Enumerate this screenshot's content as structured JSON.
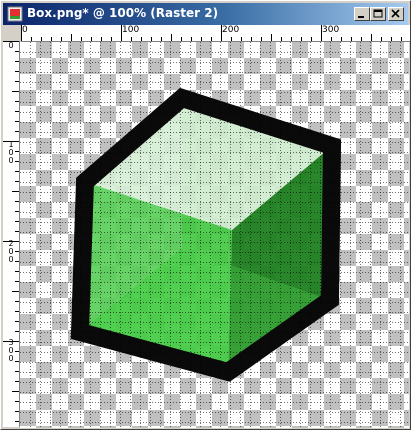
{
  "window": {
    "title": "Box.png* @ 100% (Raster 2)"
  },
  "title_buttons": {
    "minimize_icon": "minimize-icon",
    "maximize_icon": "maximize-icon",
    "close_icon": "close-icon"
  },
  "ruler": {
    "top_labels": [
      "0",
      "100",
      "200",
      "300"
    ],
    "left_labels": [
      "0",
      "100",
      "200",
      "300"
    ]
  },
  "canvas": {
    "zoom": "100%",
    "layer": "Raster 2",
    "grid": true,
    "colors": {
      "outline": "#0a0a0a",
      "face_top": "#cfeccf",
      "face_left": "#3fc83f",
      "face_right": "#1f7f1f"
    }
  }
}
